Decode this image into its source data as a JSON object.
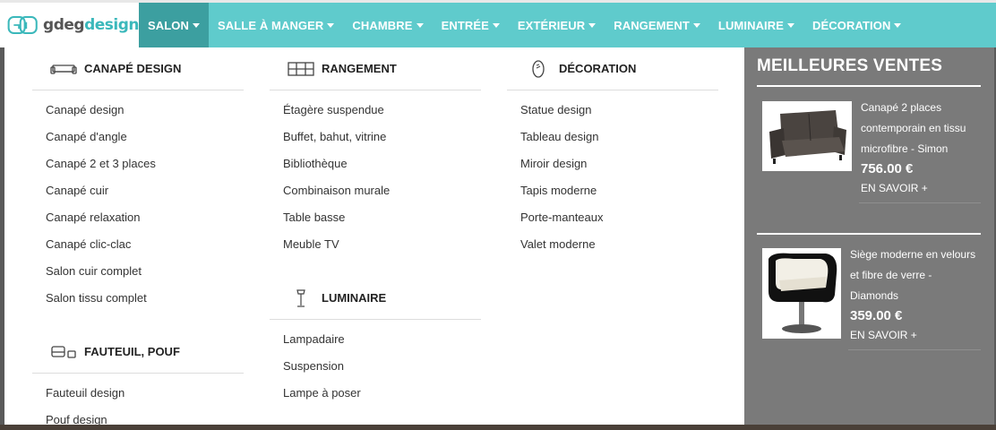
{
  "logo": {
    "text_a": "gdeg",
    "text_b": "design"
  },
  "nav": [
    {
      "label": "SALON",
      "active": true
    },
    {
      "label": "SALLE À MANGER"
    },
    {
      "label": "CHAMBRE"
    },
    {
      "label": "ENTRÉE"
    },
    {
      "label": "EXTÉRIEUR"
    },
    {
      "label": "RANGEMENT"
    },
    {
      "label": "LUMINAIRE"
    },
    {
      "label": "DÉCORATION"
    }
  ],
  "menu": {
    "canape": {
      "title": "CANAPÉ DESIGN",
      "icon": "sofa-icon",
      "links": [
        "Canapé design",
        "Canapé d'angle",
        "Canapé 2 et 3 places",
        "Canapé cuir",
        "Canapé relaxation",
        "Canapé clic-clac",
        "Salon cuir complet",
        "Salon tissu complet"
      ]
    },
    "fauteuil": {
      "title": "FAUTEUIL, POUF",
      "icon": "armchair-icon",
      "links": [
        "Fauteuil design",
        "Pouf design"
      ]
    },
    "rangement": {
      "title": "RANGEMENT",
      "icon": "shelf-icon",
      "links": [
        "Étagère suspendue",
        "Buffet, bahut, vitrine",
        "Bibliothèque",
        "Combinaison murale",
        "Table basse",
        "Meuble TV"
      ]
    },
    "luminaire": {
      "title": "LUMINAIRE",
      "icon": "floor-lamp-icon",
      "links": [
        "Lampadaire",
        "Suspension",
        "Lampe à poser"
      ]
    },
    "decoration": {
      "title": "DÉCORATION",
      "icon": "mirror-icon",
      "links": [
        "Statue design",
        "Tableau design",
        "Miroir design",
        "Tapis moderne",
        "Porte-manteaux",
        "Valet moderne"
      ]
    }
  },
  "best_sellers": {
    "title": "MEILLEURES VENTES",
    "products": [
      {
        "name_l1": "Canapé 2 places",
        "name_l2": "contemporain en tissu",
        "name_l3": "microfibre - Simon",
        "price": "756.00 €",
        "more": "EN SAVOIR +"
      },
      {
        "name_l1": "Siège moderne en velours",
        "name_l2": "et fibre de verre -",
        "name_l3": "Diamonds",
        "price": "359.00 €",
        "more": "EN SAVOIR +"
      }
    ]
  },
  "colors": {
    "nav_bg": "#5fcbcc",
    "nav_active": "#3c9fa0",
    "panel_grey": "#7a7a7a"
  }
}
